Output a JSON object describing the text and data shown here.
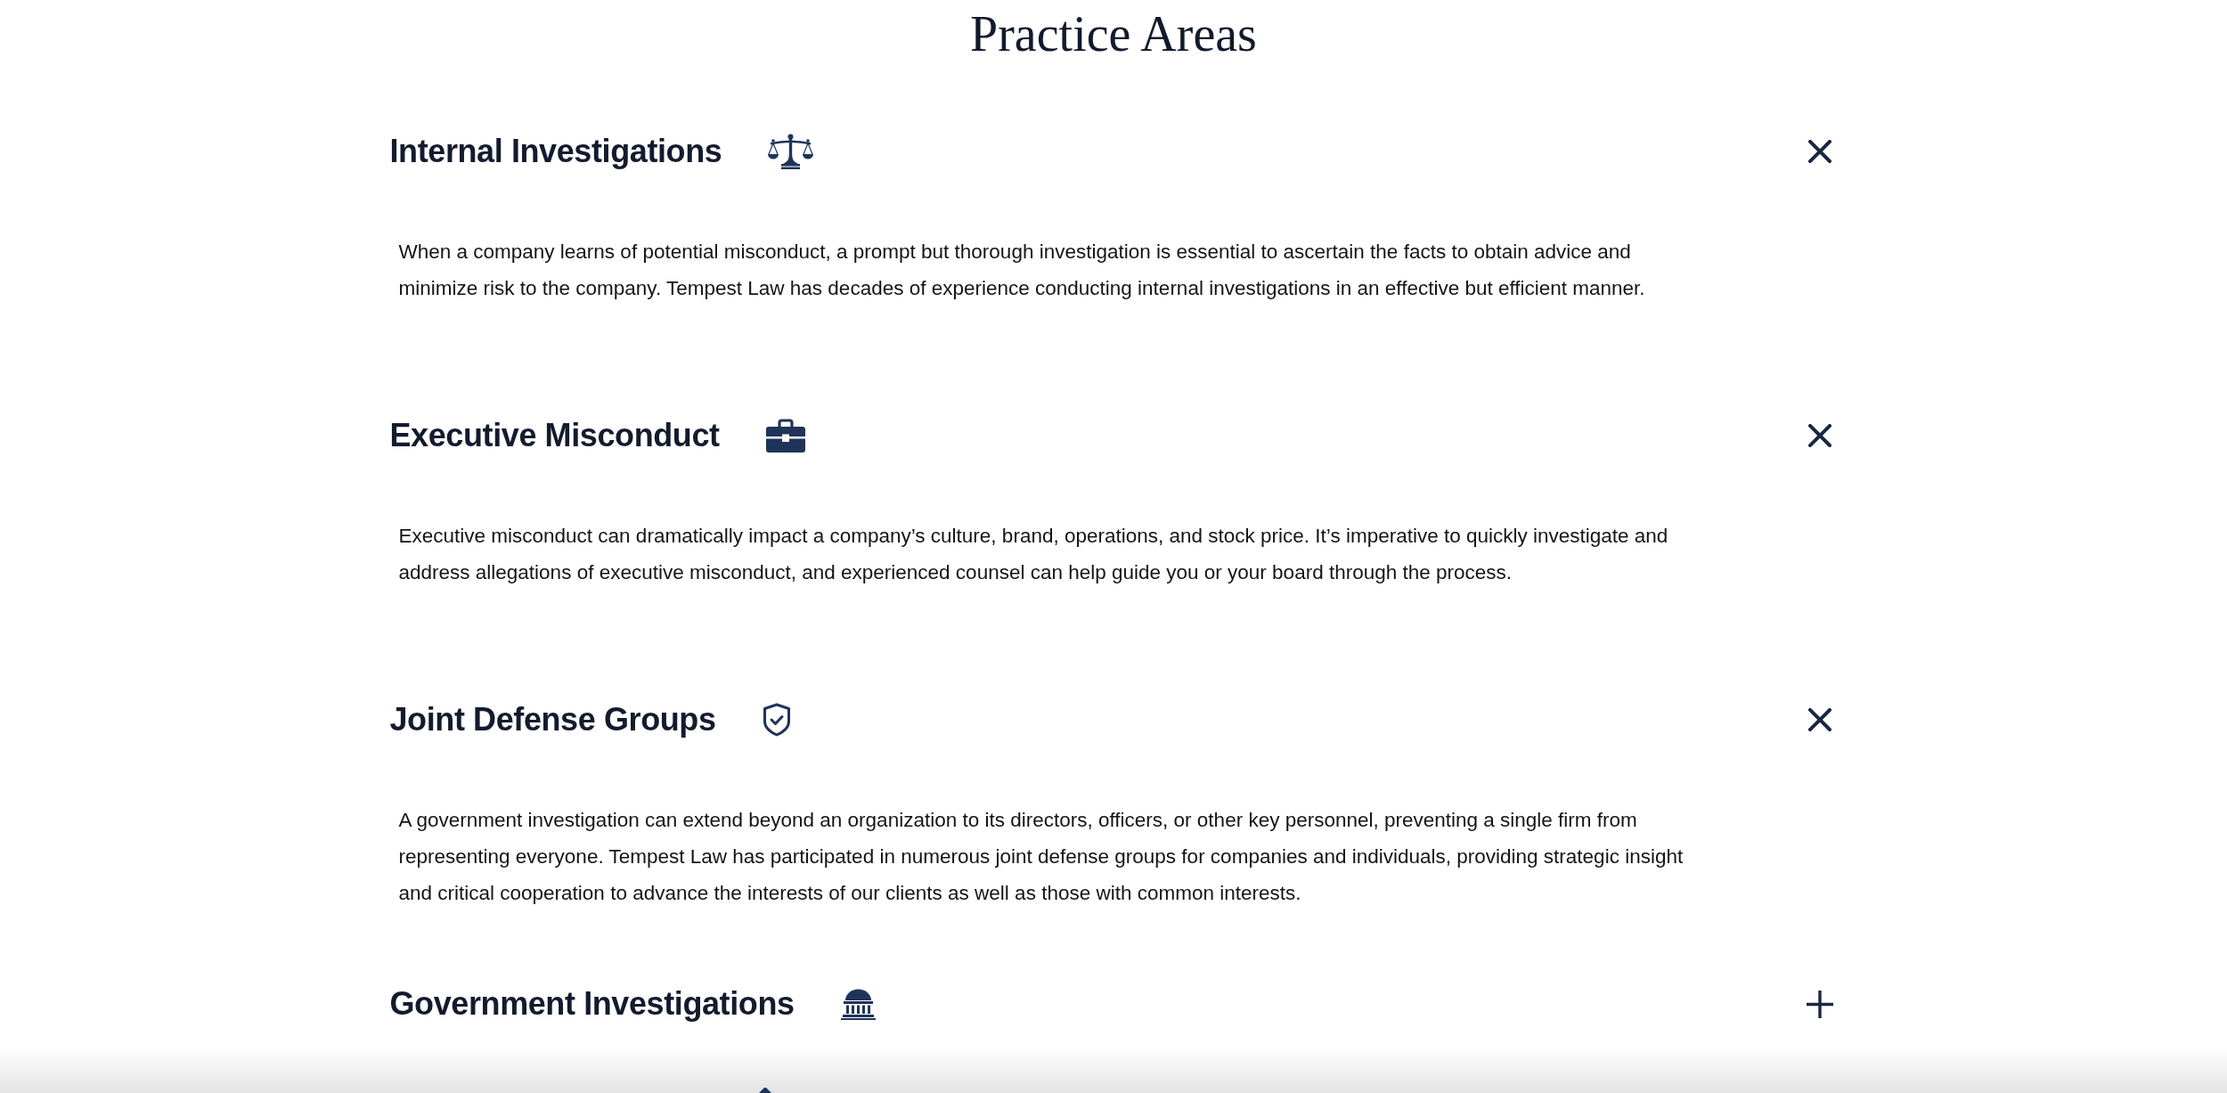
{
  "title": "Practice Areas",
  "areas": [
    {
      "name": "Internal Investigations",
      "expanded": true,
      "description": "When a company learns of potential misconduct, a prompt but thorough investigation is essential to ascertain the facts to obtain advice and minimize risk to the company. Tempest Law has decades of experience conducting internal investigations in an effective but efficient manner."
    },
    {
      "name": "Executive Misconduct",
      "expanded": true,
      "description": "Executive misconduct can dramatically impact a company’s culture, brand, operations, and stock price. It’s imperative to quickly investigate and address allegations of executive misconduct, and experienced counsel can help guide you or your board through the process."
    },
    {
      "name": "Joint Defense Groups",
      "expanded": true,
      "description": "A government investigation can extend beyond an organization to its directors, officers, or other key personnel, preventing a single firm from representing everyone. Tempest Law has participated in numerous joint defense groups for companies and individuals, providing strategic insight and critical cooperation to advance the interests of our clients as well as those with common interests."
    },
    {
      "name": "Government Investigations",
      "expanded": false
    }
  ]
}
